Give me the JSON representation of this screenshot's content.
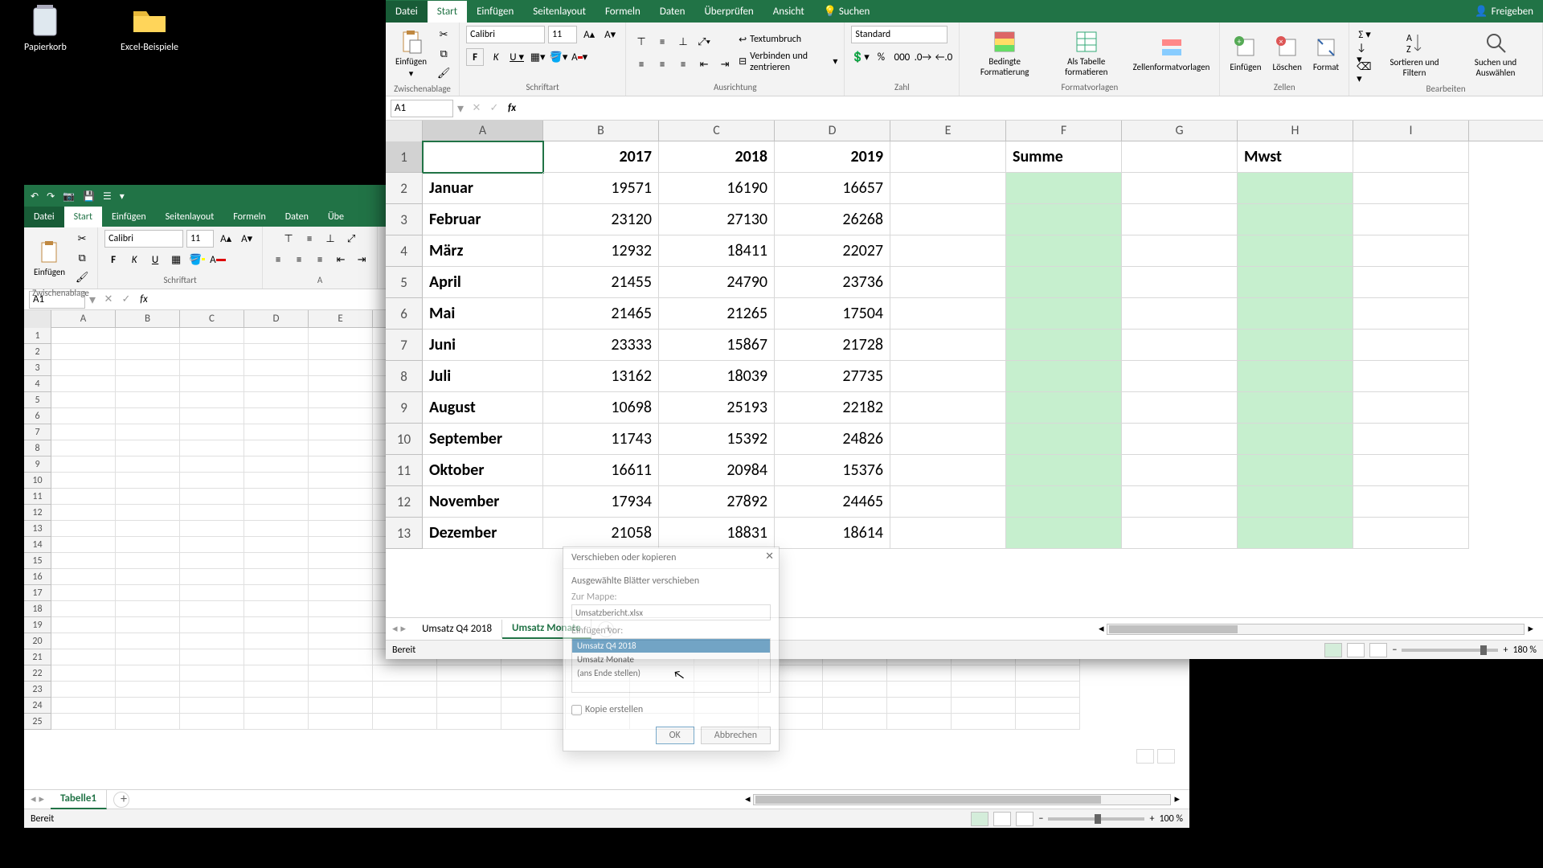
{
  "desktop": {
    "icon1": "Papierkorb",
    "icon2": "Excel-Beispiele"
  },
  "main": {
    "tabs": {
      "datei": "Datei",
      "start": "Start",
      "einfuegen": "Einfügen",
      "seitenlayout": "Seitenlayout",
      "formeln": "Formeln",
      "daten": "Daten",
      "ueberpruefen": "Überprüfen",
      "ansicht": "Ansicht",
      "suchen": "Suchen"
    },
    "share": "Freigeben",
    "groups": {
      "zwischenablage": "Zwischenablage",
      "schriftart": "Schriftart",
      "ausrichtung": "Ausrichtung",
      "zahl": "Zahl",
      "formatvorlagen": "Formatvorlagen",
      "zellen": "Zellen",
      "bearbeiten": "Bearbeiten"
    },
    "paste": "Einfügen",
    "font_name": "Calibri",
    "font_size": "11",
    "wrap": "Textumbruch",
    "merge": "Verbinden und zentrieren",
    "numfmt": "Standard",
    "cond": "Bedingte Formatierung",
    "table": "Als Tabelle formatieren",
    "cellstyles": "Zellenformatvorlagen",
    "ins": "Einfügen",
    "del": "Löschen",
    "fmt": "Format",
    "sort": "Sortieren und Filtern",
    "find": "Suchen und Auswählen",
    "namebox": "A1",
    "columns": [
      "A",
      "B",
      "C",
      "D",
      "E",
      "F",
      "G",
      "H",
      "I"
    ],
    "header": {
      "b": "2017",
      "c": "2018",
      "d": "2019",
      "f": "Summe",
      "h": "Mwst"
    },
    "rows": [
      {
        "n": "2",
        "a": "Januar",
        "b": "19571",
        "c": "16190",
        "d": "16657"
      },
      {
        "n": "3",
        "a": "Februar",
        "b": "23120",
        "c": "27130",
        "d": "26268"
      },
      {
        "n": "4",
        "a": "März",
        "b": "12932",
        "c": "18411",
        "d": "22027"
      },
      {
        "n": "5",
        "a": "April",
        "b": "21455",
        "c": "24790",
        "d": "23736"
      },
      {
        "n": "6",
        "a": "Mai",
        "b": "21465",
        "c": "21265",
        "d": "17504"
      },
      {
        "n": "7",
        "a": "Juni",
        "b": "23333",
        "c": "15867",
        "d": "21728"
      },
      {
        "n": "8",
        "a": "Juli",
        "b": "13162",
        "c": "18039",
        "d": "27735"
      },
      {
        "n": "9",
        "a": "August",
        "b": "10698",
        "c": "25193",
        "d": "22182"
      },
      {
        "n": "10",
        "a": "September",
        "b": "11743",
        "c": "15392",
        "d": "24826"
      },
      {
        "n": "11",
        "a": "Oktober",
        "b": "16611",
        "c": "20984",
        "d": "15376"
      },
      {
        "n": "12",
        "a": "November",
        "b": "17934",
        "c": "27892",
        "d": "24465"
      },
      {
        "n": "13",
        "a": "Dezember",
        "b": "21058",
        "c": "18831",
        "d": "18614"
      }
    ],
    "sheets": {
      "s1": "Umsatz Q4 2018",
      "s2": "Umsatz Monate"
    },
    "status": "Bereit",
    "zoom": "180 %"
  },
  "dialog": {
    "title": "Verschieben oder kopieren",
    "txt1": "Ausgewählte Blätter verschieben",
    "lbl_to": "Zur Mappe:",
    "combo": "Umsatzbericht.xlsx",
    "lbl_before": "Einfügen vor:",
    "items": [
      "Umsatz Q4 2018",
      "Umsatz Monate",
      "(ans Ende stellen)"
    ],
    "copy": "Kopie erstellen",
    "ok": "OK",
    "cancel": "Abbrechen"
  },
  "back": {
    "tabs": {
      "datei": "Datei",
      "start": "Start",
      "einfuegen": "Einfügen",
      "seitenlayout": "Seitenlayout",
      "formeln": "Formeln",
      "daten": "Daten",
      "ueb": "Übe"
    },
    "paste": "Einfügen",
    "groups": {
      "zwischenablage": "Zwischenablage",
      "schriftart": "Schriftart",
      "a": "A"
    },
    "font_name": "Calibri",
    "font_size": "11",
    "namebox": "A1",
    "cols": [
      "A",
      "B",
      "C",
      "D",
      "E"
    ],
    "sheet": "Tabelle1",
    "status": "Bereit",
    "zoom": "100 %"
  }
}
